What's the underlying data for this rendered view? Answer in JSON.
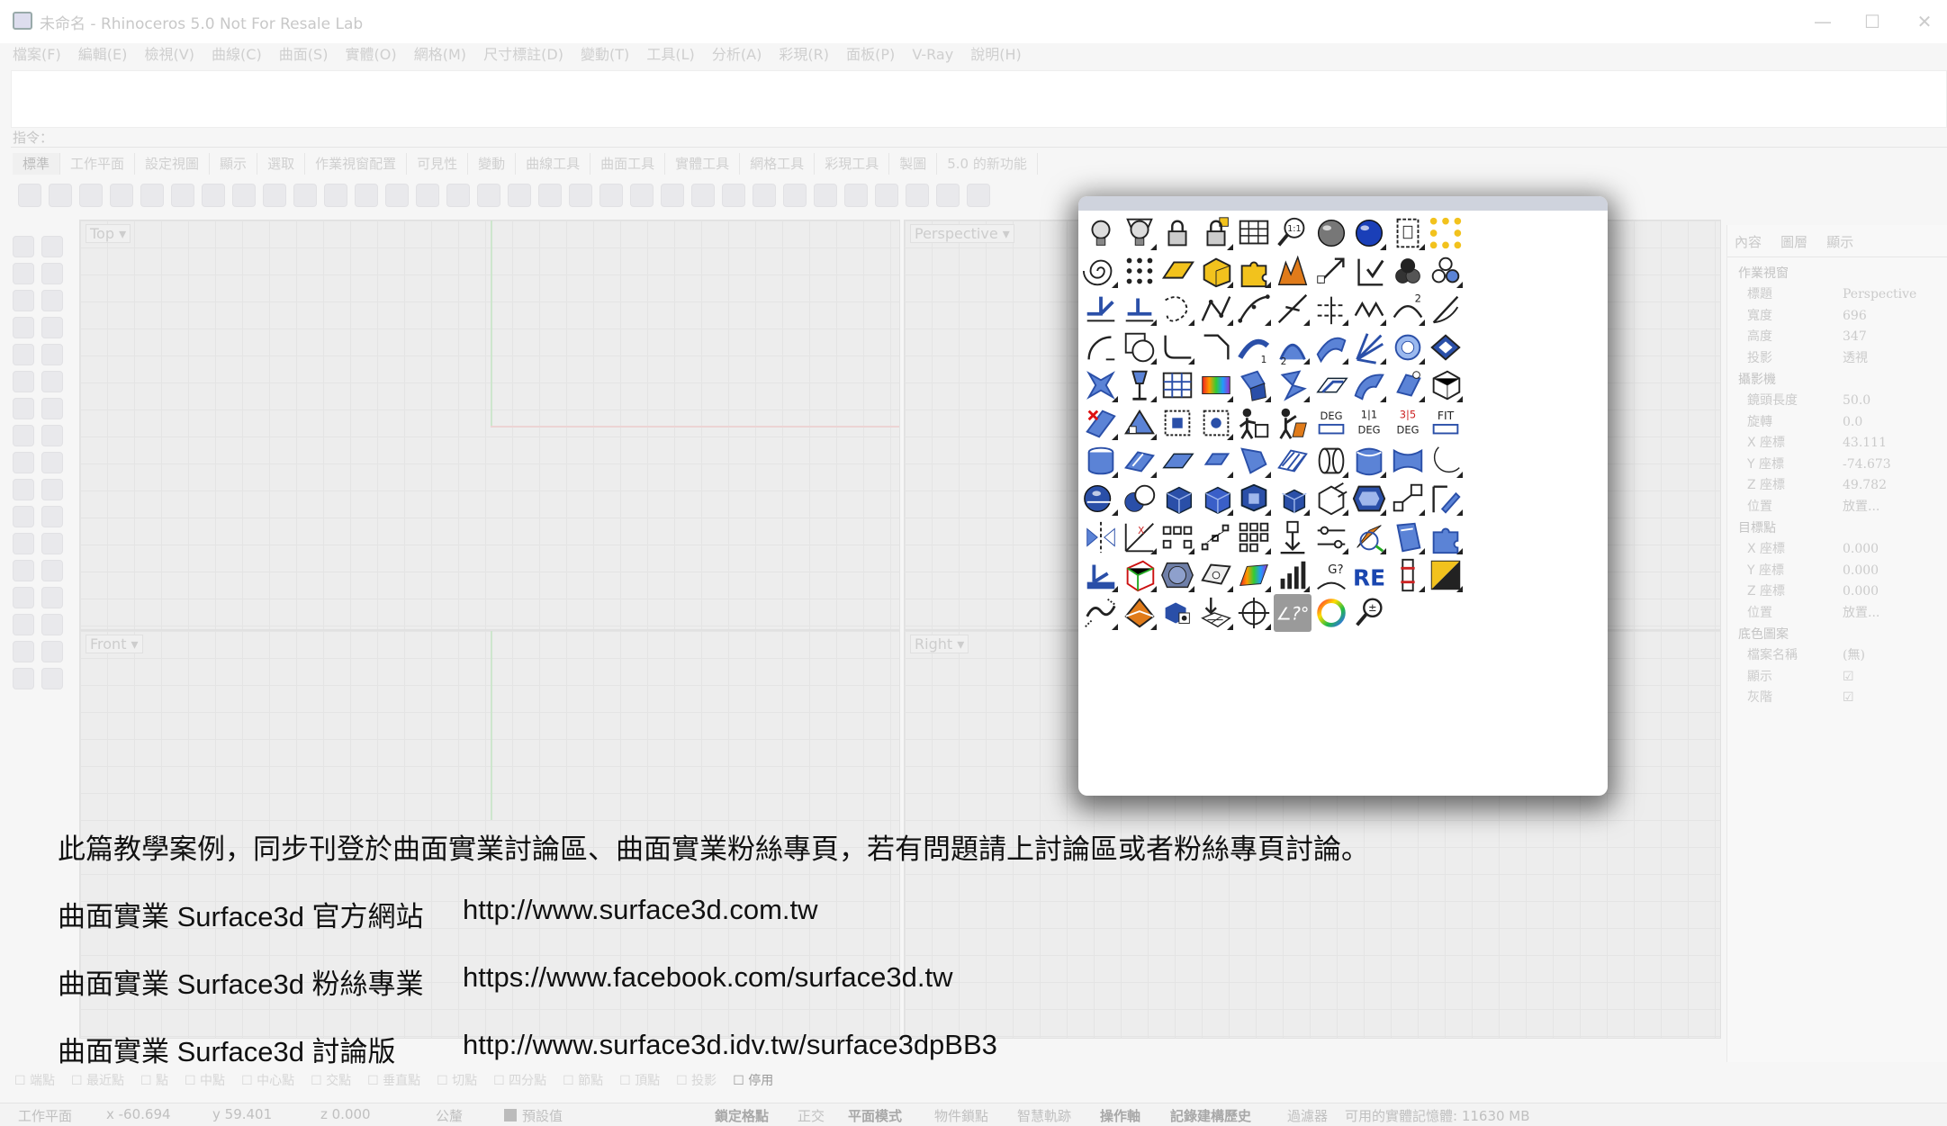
{
  "window": {
    "title": "未命名 - Rhinoceros 5.0 Not For Resale Lab",
    "controls": [
      "—",
      "☐",
      "✕"
    ]
  },
  "menu": [
    "檔案(F)",
    "編輯(E)",
    "檢視(V)",
    "曲線(C)",
    "曲面(S)",
    "實體(O)",
    "網格(M)",
    "尺寸標註(D)",
    "變動(T)",
    "工具(L)",
    "分析(A)",
    "彩現(R)",
    "面板(P)",
    "V-Ray",
    "說明(H)"
  ],
  "command": {
    "label": "指令："
  },
  "toolbar_tabs": [
    "標準",
    "工作平面",
    "設定視圖",
    "顯示",
    "選取",
    "作業視窗配置",
    "可見性",
    "變動",
    "曲線工具",
    "曲面工具",
    "實體工具",
    "網格工具",
    "彩現工具",
    "製圖",
    "5.0 的新功能"
  ],
  "viewports": [
    {
      "label": "Top ▾"
    },
    {
      "label": "Perspective ▾"
    },
    {
      "label": "Front ▾"
    },
    {
      "label": "Right ▾"
    }
  ],
  "panel": {
    "tabs": [
      "內容",
      "圖層",
      "顯示"
    ],
    "sections": [
      {
        "title": "作業視窗",
        "rows": [
          {
            "k": "標題",
            "v": "Perspective"
          },
          {
            "k": "寬度",
            "v": "696"
          },
          {
            "k": "高度",
            "v": "347"
          },
          {
            "k": "投影",
            "v": "透視"
          }
        ]
      },
      {
        "title": "攝影機",
        "rows": [
          {
            "k": "鏡頭長度",
            "v": "50.0"
          },
          {
            "k": "旋轉",
            "v": "0.0"
          },
          {
            "k": "X 座標",
            "v": "43.111"
          },
          {
            "k": "Y 座標",
            "v": "-74.673"
          },
          {
            "k": "Z 座標",
            "v": "49.782"
          },
          {
            "k": "位置",
            "v": "放置..."
          }
        ]
      },
      {
        "title": "目標點",
        "rows": [
          {
            "k": "X 座標",
            "v": "0.000"
          },
          {
            "k": "Y 座標",
            "v": "0.000"
          },
          {
            "k": "Z 座標",
            "v": "0.000"
          },
          {
            "k": "位置",
            "v": "放置..."
          }
        ]
      },
      {
        "title": "底色圖案",
        "rows": [
          {
            "k": "檔案名稱",
            "v": "(無)"
          },
          {
            "k": "顯示",
            "v": "☑"
          },
          {
            "k": "灰階",
            "v": "☑"
          }
        ]
      }
    ]
  },
  "osnap": [
    "端點",
    "最近點",
    "點",
    "中點",
    "中心點",
    "交點",
    "垂直點",
    "切點",
    "四分點",
    "節點",
    "頂點",
    "投影",
    "停用"
  ],
  "status": {
    "cplane": "工作平面",
    "x": "x -60.694",
    "y": "y 59.401",
    "z": "z 0.000",
    "unit": "公釐",
    "layer": "預設值",
    "items": [
      "鎖定格點",
      "正交",
      "平面模式",
      "物件鎖點",
      "智慧軌跡",
      "操作軸",
      "記錄建構歷史",
      "過濾器",
      "可用的實體記憶體: 11630 MB"
    ]
  },
  "popup": {
    "text_icons": {
      "deg1": "DEG",
      "deg2": "1|1 DEG",
      "deg3": "3|5 DEG",
      "fit": "FIT",
      "re": "RE",
      "angle": "∠?°",
      "one_to_one": "1:1",
      "n1": "1",
      "n2": "2"
    }
  },
  "captions": [
    {
      "text": "此篇教學案例，同步刊登於曲面實業討論區、曲面實業粉絲專頁，若有問題請上討論區或者粉絲專頁討論。",
      "url": ""
    },
    {
      "text": "曲面實業 Surface3d 官方網站",
      "url": "http://www.surface3d.com.tw"
    },
    {
      "text": "曲面實業 Surface3d 粉絲專業",
      "url": "https://www.facebook.com/surface3d.tw"
    },
    {
      "text": "曲面實業 Surface3d 討論版",
      "url": "http://www.surface3d.idv.tw/surface3dpBB3"
    }
  ]
}
